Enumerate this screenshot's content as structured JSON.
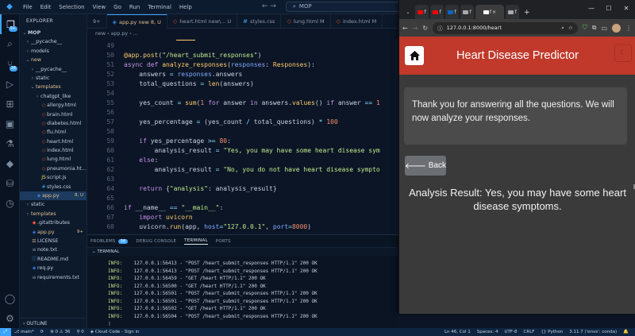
{
  "vscode": {
    "menu": [
      "File",
      "Edit",
      "Selection",
      "View",
      "Go",
      "Run",
      "Terminal",
      "Help"
    ],
    "search_title": "MOP",
    "activity": [
      {
        "icon": "files-icon",
        "badge": "9+"
      },
      {
        "icon": "search-icon",
        "badge": ""
      },
      {
        "icon": "source-control-icon",
        "badge": "28"
      },
      {
        "icon": "run-debug-icon",
        "badge": ""
      },
      {
        "icon": "extensions-icon",
        "badge": ""
      },
      {
        "icon": "remote-explorer-icon",
        "badge": ""
      },
      {
        "icon": "testing-icon",
        "badge": ""
      },
      {
        "icon": "docker-icon",
        "badge": ""
      },
      {
        "icon": "database-icon",
        "badge": ""
      },
      {
        "icon": "chat-icon",
        "badge": ""
      }
    ],
    "explorer": {
      "header": "EXPLORER",
      "root": "MOP",
      "items": [
        {
          "name": "__pycache__",
          "indent": 1,
          "arrow": "›",
          "icon": "folder",
          "status": ""
        },
        {
          "name": "models",
          "indent": 1,
          "arrow": "›",
          "icon": "folder",
          "status": ""
        },
        {
          "name": "new",
          "indent": 1,
          "arrow": "⌄",
          "icon": "folder",
          "status": "",
          "cls": "modified"
        },
        {
          "name": "__pycache__",
          "indent": 2,
          "arrow": "›",
          "icon": "folder",
          "status": ""
        },
        {
          "name": "static",
          "indent": 2,
          "arrow": "›",
          "icon": "folder",
          "status": ""
        },
        {
          "name": "templates",
          "indent": 2,
          "arrow": "⌄",
          "icon": "folder",
          "status": "",
          "cls": "modified"
        },
        {
          "name": "chatgpt_like",
          "indent": 3,
          "arrow": "›",
          "icon": "folder",
          "status": ""
        },
        {
          "name": "allergy.html",
          "indent": 3,
          "arrow": "",
          "icon": "html",
          "status": ""
        },
        {
          "name": "brain.html",
          "indent": 3,
          "arrow": "",
          "icon": "html",
          "status": ""
        },
        {
          "name": "diabetes.html",
          "indent": 3,
          "arrow": "",
          "icon": "html",
          "status": ""
        },
        {
          "name": "flu.html",
          "indent": 3,
          "arrow": "",
          "icon": "html",
          "status": ""
        },
        {
          "name": "heart.html",
          "indent": 3,
          "arrow": "",
          "icon": "html",
          "status": ""
        },
        {
          "name": "index.html",
          "indent": 3,
          "arrow": "",
          "icon": "html",
          "status": ""
        },
        {
          "name": "lung.html",
          "indent": 3,
          "arrow": "",
          "icon": "html",
          "status": ""
        },
        {
          "name": "pneumonia.ht...",
          "indent": 3,
          "arrow": "",
          "icon": "html",
          "status": ""
        },
        {
          "name": "script.js",
          "indent": 3,
          "arrow": "",
          "icon": "js",
          "status": ""
        },
        {
          "name": "styles.css",
          "indent": 3,
          "arrow": "",
          "icon": "css",
          "status": ""
        },
        {
          "name": "app.py",
          "indent": 2,
          "arrow": "",
          "icon": "py",
          "status": "8, U",
          "sel": true,
          "cls": "modified"
        },
        {
          "name": "static",
          "indent": 1,
          "arrow": "›",
          "icon": "folder",
          "status": ""
        },
        {
          "name": "templates",
          "indent": 1,
          "arrow": "›",
          "icon": "folder",
          "status": "",
          "cls": "modified"
        },
        {
          "name": ".gitattributes",
          "indent": 1,
          "arrow": "",
          "icon": "git",
          "status": ""
        },
        {
          "name": "app.py",
          "indent": 1,
          "arrow": "",
          "icon": "py",
          "status": "9+",
          "cls": "modified"
        },
        {
          "name": "LICENSE",
          "indent": 1,
          "arrow": "",
          "icon": "license",
          "status": ""
        },
        {
          "name": "note.txt",
          "indent": 1,
          "arrow": "",
          "icon": "txt",
          "status": ""
        },
        {
          "name": "README.md",
          "indent": 1,
          "arrow": "",
          "icon": "md",
          "status": ""
        },
        {
          "name": "req.py",
          "indent": 1,
          "arrow": "",
          "icon": "py",
          "status": ""
        },
        {
          "name": "requirements.txt",
          "indent": 1,
          "arrow": "",
          "icon": "txt",
          "status": ""
        }
      ],
      "outline": "OUTLINE"
    },
    "tabs": [
      {
        "label": "9+",
        "icon": "",
        "active": false
      },
      {
        "label": "app.py  new 8, U",
        "icon": "py",
        "active": true
      },
      {
        "label": "heart.html  new\\... U",
        "icon": "html",
        "active": false
      },
      {
        "label": "styles.css",
        "icon": "css",
        "active": false
      },
      {
        "label": "lung.html  M",
        "icon": "html",
        "active": false
      },
      {
        "label": "index.html  M",
        "icon": "html",
        "active": false
      }
    ],
    "breadcrumb": "new  ›  app.py  ›  ...",
    "code": [
      {
        "n": "49",
        "html": ""
      },
      {
        "n": "50",
        "html": "<span class='dec'>@app</span>.<span class='fn'>post</span>(<span class='st'>\"/heart_submit_responses\"</span>)"
      },
      {
        "n": "51",
        "html": "<span class='kw'>async def</span> <span class='fn'>analyze_responses</span>(<span class='va'>responses</span>: <span class='ty'>Responses</span>):"
      },
      {
        "n": "52",
        "html": "    answers <span class='op'>=</span> <span class='va'>responses</span>.answers"
      },
      {
        "n": "53",
        "html": "    total_questions <span class='op'>=</span> <span class='fn'>len</span>(answers)"
      },
      {
        "n": "54",
        "html": ""
      },
      {
        "n": "55",
        "html": "    yes_count <span class='op'>=</span> <span class='fn'>sum</span>(<span class='nu'>1</span> <span class='kw'>for</span> answer <span class='kw'>in</span> answers.<span class='fn'>values</span>() <span class='kw'>if</span> answer <span class='op'>==</span> <span class='nu'>1</span>"
      },
      {
        "n": "56",
        "html": ""
      },
      {
        "n": "57",
        "html": "    yes_percentage <span class='op'>=</span> (yes_count <span class='op'>/</span> total_questions) <span class='op'>*</span> <span class='nu'>100</span>"
      },
      {
        "n": "58",
        "html": ""
      },
      {
        "n": "59",
        "html": "    <span class='kw'>if</span> yes_percentage <span class='op'>&gt;=</span> <span class='nu'>80</span>:"
      },
      {
        "n": "60",
        "html": "        analysis_result <span class='op'>=</span> <span class='st'>\"Yes, you may have some heart disease sym</span>"
      },
      {
        "n": "61",
        "html": "    <span class='kw'>else</span>:"
      },
      {
        "n": "62",
        "html": "        analysis_result <span class='op'>=</span> <span class='st'>\"No, you do not have heart disease sympto</span>"
      },
      {
        "n": "63",
        "html": ""
      },
      {
        "n": "64",
        "html": "    <span class='kw'>return</span> {<span class='st'>\"analysis\"</span>: analysis_result}"
      },
      {
        "n": "65",
        "html": ""
      },
      {
        "n": "66",
        "html": "<span class='kw'>if</span> __name__ <span class='op'>==</span> <span class='st'>\"__main__\"</span>:"
      },
      {
        "n": "67",
        "html": "    <span class='kw'>import</span> <span class='fn'>uvicorn</span>"
      },
      {
        "n": "68",
        "html": "    uvicorn.<span class='fn'>run</span>(app, <span class='va'>host</span><span class='op'>=</span><span class='st'>\"127.0.0.1\"</span>, <span class='va'>port</span><span class='op'>=</span><span class='nu'>8000</span>)"
      }
    ],
    "panel": {
      "tabs": [
        {
          "label": "PROBLEMS",
          "badge": "36",
          "active": false
        },
        {
          "label": "DEBUG CONSOLE",
          "badge": "",
          "active": false
        },
        {
          "label": "TERMINAL",
          "badge": "",
          "active": true
        },
        {
          "label": "PORTS",
          "badge": "",
          "active": false
        }
      ],
      "terminal_header": "TERMINAL",
      "lines": [
        {
          "level": "INFO:",
          "text": "127.0.0.1:56413 - \"POST /heart_submit_responses HTTP/1.1\" 200 OK"
        },
        {
          "level": "INFO:",
          "text": "127.0.0.1:56413 - \"POST /heart_submit_responses HTTP/1.1\" 200 OK"
        },
        {
          "level": "INFO:",
          "text": "127.0.0.1:56459 - \"GET /heart HTTP/1.1\" 200 OK"
        },
        {
          "level": "INFO:",
          "text": "127.0.0.1:56500 - \"GET /heart HTTP/1.1\" 200 OK"
        },
        {
          "level": "INFO:",
          "text": "127.0.0.1:56501 - \"POST /heart_submit_responses HTTP/1.1\" 200 OK"
        },
        {
          "level": "INFO:",
          "text": "127.0.0.1:56501 - \"POST /heart_submit_responses HTTP/1.1\" 200 OK"
        },
        {
          "level": "INFO:",
          "text": "127.0.0.1:56502 - \"GET /heart HTTP/1.1\" 200 OK"
        },
        {
          "level": "INFO:",
          "text": "127.0.0.1:56504 - \"POST /heart_submit_responses HTTP/1.1\" 200 OK"
        }
      ]
    },
    "status": {
      "branch": "main*",
      "sync": "⟳",
      "problems": "⊗ 0  ⚠ 36",
      "ports": "⚲ 0",
      "cloud": "Cloud Code - Sign in",
      "position": "Ln 46, Col 1",
      "spaces": "Spaces: 4",
      "encoding": "UTF-8",
      "eol": "CRLF",
      "language": "{} Python",
      "interpreter": "3.11.7 ('envs': conda)"
    }
  },
  "browser": {
    "tabs": [
      {
        "fav": "#ff0000",
        "label": "f",
        "active": false
      },
      {
        "fav": "#ff0000",
        "label": "f",
        "active": false
      },
      {
        "fav": "#0a66c2",
        "label": "f",
        "active": false
      },
      {
        "fav": "#aaaaaa",
        "label": "f",
        "active": false
      },
      {
        "fav": "#ffffff",
        "label": "f",
        "active": true
      },
      {
        "fav": "#aaaaaa",
        "label": "f",
        "active": false
      }
    ],
    "url": "127.0.0.1:8000/heart",
    "app_title": "Heart Disease Predictor",
    "message": "Thank you for answering all the questions. We will now analyze your responses.",
    "back_label": "Back",
    "result": "Analysis Result: Yes, you may have some heart disease symptoms.",
    "colors": {
      "appbar": "#c0392b",
      "page_bg": "#3a3a3a",
      "card": "#4b4b4b",
      "back_btn": "#6b6e72"
    }
  }
}
